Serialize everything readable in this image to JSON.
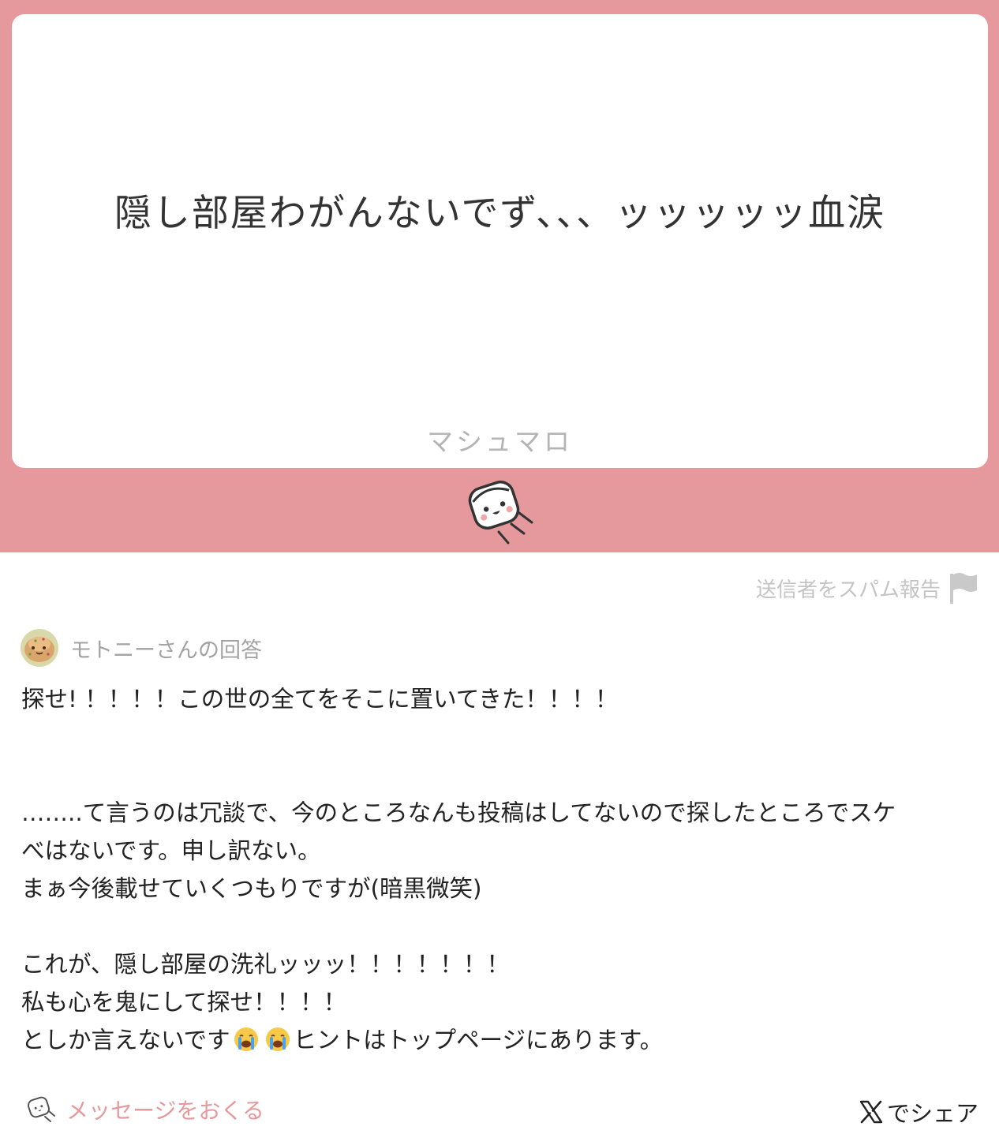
{
  "card": {
    "question": "隠し部屋わがんないでず、、、ッッッッッ血涙",
    "brand": "マシュマロ"
  },
  "report_spam_label": "送信者をスパム報告",
  "answer": {
    "heading": "モトニーさんの回答",
    "lines": [
      "探せ! ！！！！この世の全てをそこに置いてきた！！！！",
      "",
      "",
      "……..て言うのは冗談で、今のところなんも投稿はしてないので探したところでスケ",
      "べはないです。申し訳ない。",
      "まぁ今後載せていくつもりですが(暗黒微笑)",
      "",
      "これが、隠し部屋の洗礼ッッッ！！！！！！！",
      "私も心を鬼にして探せ！！！！"
    ],
    "last_line_before": "としか言えないです",
    "last_line_after": "ヒントはトップページにあります。"
  },
  "footer": {
    "send_message": "メッセージをおくる",
    "share_label": "でシェア"
  },
  "colors": {
    "accent": "#e6999c",
    "muted": "#c4c4c4"
  },
  "icons": [
    "marshmallow-mascot-icon",
    "flag-icon",
    "avatar-image",
    "crying-face-icon",
    "marshmallow-small-icon",
    "x-logo-icon"
  ]
}
